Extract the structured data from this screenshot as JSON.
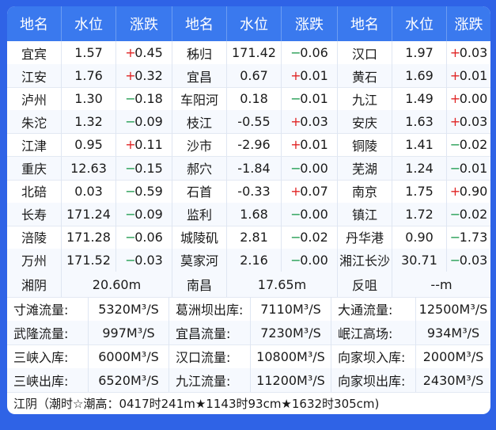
{
  "headers": [
    "地名",
    "水位",
    "涨跌",
    "地名",
    "水位",
    "涨跌",
    "地名",
    "水位",
    "涨跌"
  ],
  "stations": [
    [
      [
        "宜宾",
        "1.57",
        "+",
        "0.45"
      ],
      [
        "秭归",
        "171.42",
        "-",
        "0.06"
      ],
      [
        "汉口",
        "1.97",
        "+",
        "0.03"
      ]
    ],
    [
      [
        "江安",
        "1.76",
        "+",
        "0.32"
      ],
      [
        "宜昌",
        "0.67",
        "+",
        "0.01"
      ],
      [
        "黄石",
        "1.69",
        "+",
        "0.01"
      ]
    ],
    [
      [
        "泸州",
        "1.30",
        "-",
        "0.18"
      ],
      [
        "车阳河",
        "0.18",
        "-",
        "0.01"
      ],
      [
        "九江",
        "1.49",
        "+",
        "0.00"
      ]
    ],
    [
      [
        "朱沱",
        "1.32",
        "-",
        "0.09"
      ],
      [
        "枝江",
        "-0.55",
        "+",
        "0.03"
      ],
      [
        "安庆",
        "1.63",
        "+",
        "0.03"
      ]
    ],
    [
      [
        "江津",
        "0.95",
        "+",
        "0.11"
      ],
      [
        "沙市",
        "-2.96",
        "+",
        "0.01"
      ],
      [
        "铜陵",
        "1.41",
        "-",
        "0.02"
      ]
    ],
    [
      [
        "重庆",
        "12.63",
        "-",
        "0.15"
      ],
      [
        "郝穴",
        "-1.84",
        "-",
        "0.00"
      ],
      [
        "芜湖",
        "1.24",
        "-",
        "0.01"
      ]
    ],
    [
      [
        "北碚",
        "0.03",
        "-",
        "0.59"
      ],
      [
        "石首",
        "-0.33",
        "+",
        "0.07"
      ],
      [
        "南京",
        "1.75",
        "+",
        "0.90"
      ]
    ],
    [
      [
        "长寿",
        "171.24",
        "-",
        "0.09"
      ],
      [
        "监利",
        "1.68",
        "-",
        "0.00"
      ],
      [
        "镇江",
        "1.72",
        "-",
        "0.02"
      ]
    ],
    [
      [
        "涪陵",
        "171.28",
        "-",
        "0.06"
      ],
      [
        "城陵矶",
        "2.81",
        "-",
        "0.02"
      ],
      [
        "丹华港",
        "0.90",
        "-",
        "1.73"
      ]
    ],
    [
      [
        "万州",
        "171.52",
        "-",
        "0.03"
      ],
      [
        "莫家河",
        "2.16",
        "-",
        "0.00"
      ],
      [
        "湘江长沙",
        "30.71",
        "-",
        "0.03"
      ]
    ]
  ],
  "extra_levels": [
    {
      "name": "湘阴",
      "value": "20.60m"
    },
    {
      "name": "南昌",
      "value": "17.65m"
    },
    {
      "name": "反咀",
      "value": "--m"
    }
  ],
  "flows": [
    [
      {
        "label": "寸滩流量:",
        "value": "5320M³/S"
      },
      {
        "label": "葛洲坝出库:",
        "value": "7110M³/S"
      },
      {
        "label": "大通流量:",
        "value": "12500M³/S"
      }
    ],
    [
      {
        "label": "武隆流量:",
        "value": "997M³/S"
      },
      {
        "label": "宜昌流量:",
        "value": "7230M³/S"
      },
      {
        "label": "岷江高场:",
        "value": "934M³/S"
      }
    ],
    [
      {
        "label": "三峡入库:",
        "value": "6000M³/S"
      },
      {
        "label": "汉口流量:",
        "value": "10800M³/S"
      },
      {
        "label": "向家坝入库:",
        "value": "2000M³/S"
      }
    ],
    [
      {
        "label": "三峡出库:",
        "value": "6520M³/S"
      },
      {
        "label": "九江流量:",
        "value": "11200M³/S"
      },
      {
        "label": "向家坝出库:",
        "value": "2430M³/S"
      }
    ]
  ],
  "tide_text": "江阴（潮时☆潮高：0417时241m★1143时93cm★1632时305cm)",
  "colors": {
    "header": "#3a79ee",
    "up": "#e02424",
    "down": "#1d9a4d",
    "frame": "#2f63e6"
  }
}
